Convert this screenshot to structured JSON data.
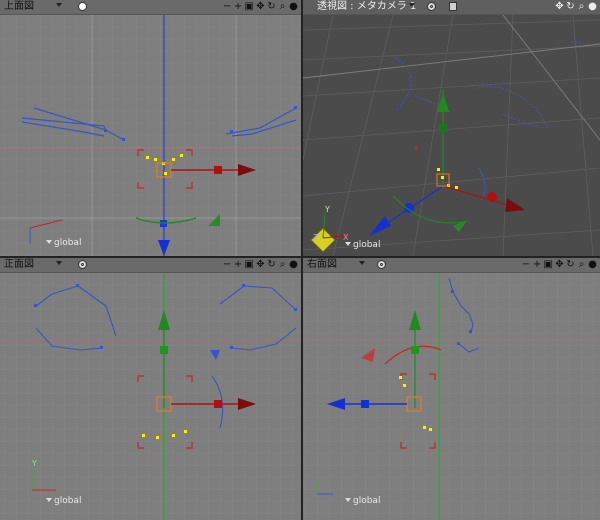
{
  "viewports": {
    "top": {
      "title": "上面図",
      "coord": "global"
    },
    "persp": {
      "title": "透視図 : メタカメラ 1",
      "coord": "global"
    },
    "front": {
      "title": "正面図",
      "coord": "global"
    },
    "right": {
      "title": "右面図",
      "coord": "global"
    }
  },
  "tools": {
    "minus": "−",
    "plus": "+",
    "camera": "▣",
    "move": "✥",
    "rotate": "↻",
    "zoom": "⌕",
    "sphere": "●"
  },
  "axis_labels": {
    "x": "X",
    "y": "Y",
    "z": "Z"
  },
  "colors": {
    "x_axis": "#b01010",
    "y_axis": "#1f8a1f",
    "z_axis": "#1530d0",
    "curve": "#3555c8",
    "selection": "#ffee00",
    "bracket": "#cc2222",
    "grid_light": "#8c8c8c",
    "grid_persp": "#5a5a5a"
  },
  "icons": {
    "display_mode": "display-mode-icon",
    "target": "target-icon",
    "cube": "cube-icon"
  }
}
